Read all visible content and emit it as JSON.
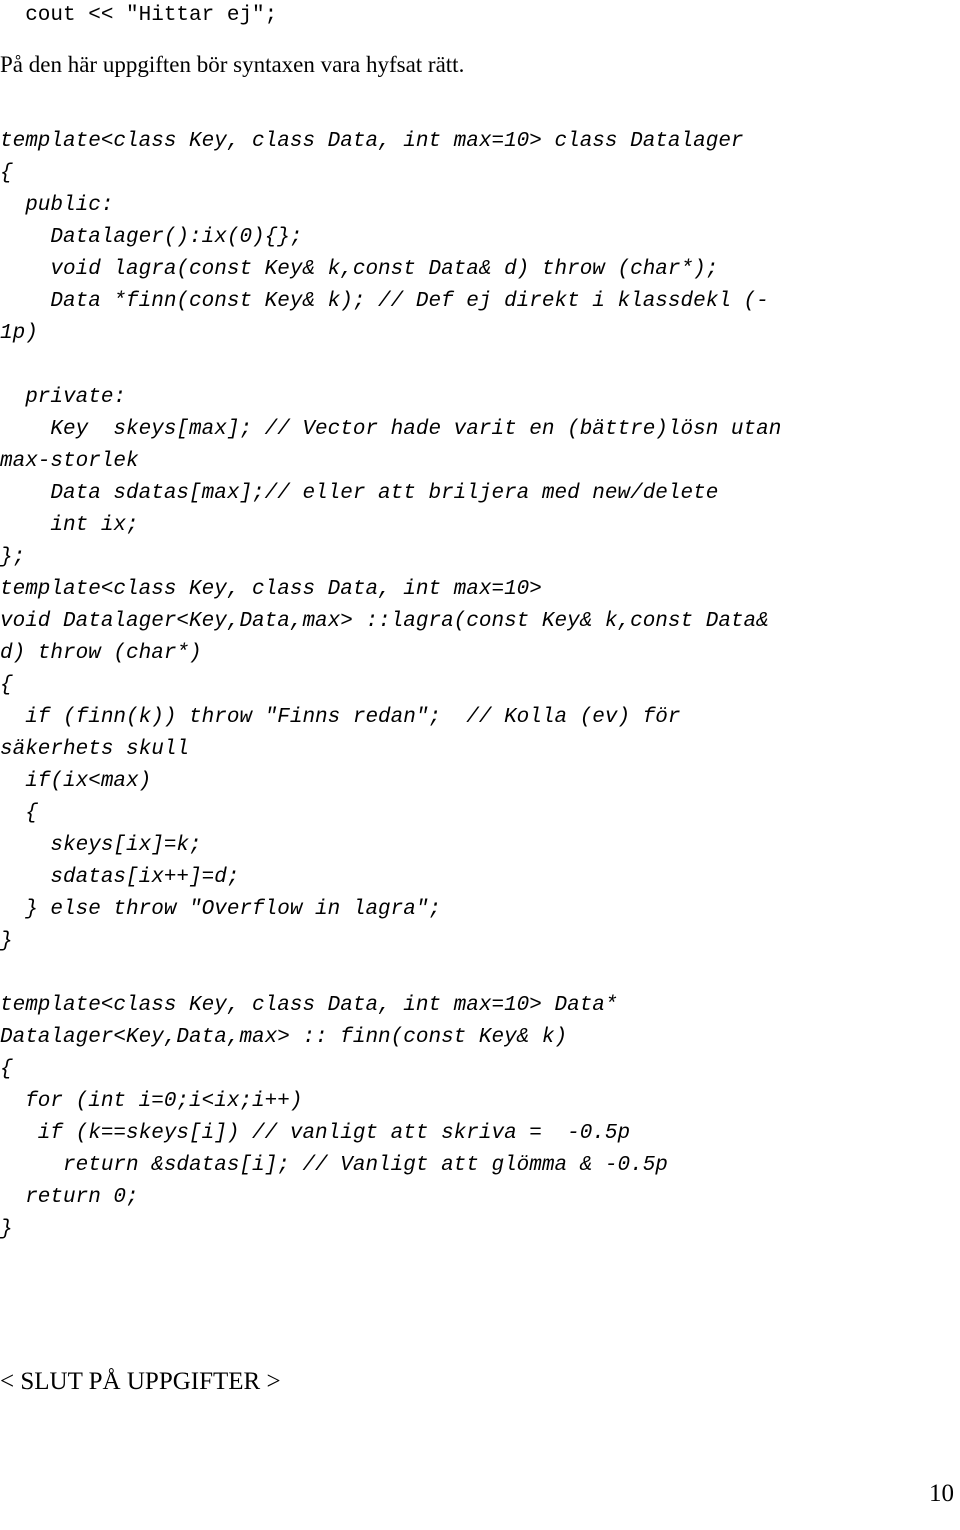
{
  "document": {
    "top_code_line": "  cout << \"Hittar ej\";",
    "intro_paragraph": "På den här uppgiften bör syntaxen vara hyfsat rätt.",
    "code_block_1": [
      "template<class Key, class Data, int max=10> class Datalager",
      "{",
      "  public:",
      "    Datalager():ix(0){};",
      "    void lagra(const Key& k,const Data& d) throw (char*);",
      "    Data *finn(const Key& k); // Def ej direkt i klassdekl (-",
      "1p)",
      "",
      "  private:",
      "    Key  skeys[max]; // Vector hade varit en (bättre)lösn utan",
      "max-storlek",
      "    Data sdatas[max];// eller att briljera med new/delete",
      "    int ix;",
      "};",
      "template<class Key, class Data, int max=10>",
      "void Datalager<Key,Data,max> ::lagra(const Key& k,const Data&",
      "d) throw (char*)",
      "{",
      "  if (finn(k)) throw \"Finns redan\";  // Kolla (ev) för",
      "säkerhets skull",
      "  if(ix<max)",
      "  {",
      "    skeys[ix]=k;",
      "    sdatas[ix++]=d;",
      "  } else throw \"Overflow in lagra\";",
      "}"
    ],
    "code_block_2": [
      "template<class Key, class Data, int max=10> Data*",
      "Datalager<Key,Data,max> :: finn(const Key& k)",
      "{",
      "  for (int i=0;i<ix;i++)",
      "   if (k==skeys[i]) // vanligt att skriva =  -0.5p",
      "     return &sdatas[i]; // Vanligt att glömma & -0.5p",
      "  return 0;",
      "}"
    ],
    "end_marker": "< SLUT PÅ UPPGIFTER >",
    "page_number": "10"
  }
}
